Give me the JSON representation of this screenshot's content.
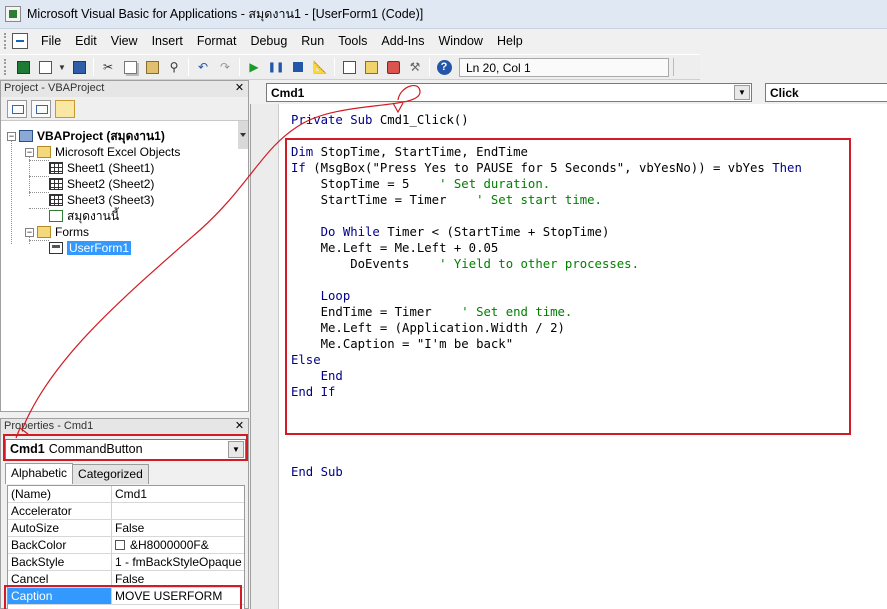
{
  "window": {
    "title": "Microsoft Visual Basic for Applications - สมุดงาน1 - [UserForm1 (Code)]"
  },
  "menu": {
    "items": [
      "File",
      "Edit",
      "View",
      "Insert",
      "Format",
      "Debug",
      "Run",
      "Tools",
      "Add-Ins",
      "Window",
      "Help"
    ]
  },
  "toolbar": {
    "position": "Ln 20, Col 1"
  },
  "project": {
    "title": "Project - VBAProject",
    "close": "✕",
    "tree": {
      "root": "VBAProject (สมุดงาน1)",
      "excel_objects": "Microsoft Excel Objects",
      "sheets": [
        "Sheet1 (Sheet1)",
        "Sheet2 (Sheet2)",
        "Sheet3 (Sheet3)"
      ],
      "workbook": "สมุดงานนี้",
      "forms": "Forms",
      "form": "UserForm1"
    }
  },
  "properties": {
    "title": "Properties - Cmd1",
    "close": "✕",
    "object_name": "Cmd1",
    "object_type": "CommandButton",
    "tabs": [
      "Alphabetic",
      "Categorized"
    ],
    "rows": [
      {
        "name": "(Name)",
        "value": "Cmd1"
      },
      {
        "name": "Accelerator",
        "value": ""
      },
      {
        "name": "AutoSize",
        "value": "False"
      },
      {
        "name": "BackColor",
        "value": "&H8000000F&"
      },
      {
        "name": "BackStyle",
        "value": "1 - fmBackStyleOpaque"
      },
      {
        "name": "Cancel",
        "value": "False"
      },
      {
        "name": "Caption",
        "value": "MOVE USERFORM"
      }
    ]
  },
  "code": {
    "object_combo": "Cmd1",
    "proc_combo": "Click",
    "lines": [
      {
        "kw1": "Private Sub ",
        "rest": "Cmd1_Click()",
        "comment": ""
      },
      {
        "kw1": "",
        "rest": "",
        "comment": ""
      },
      {
        "kw1": "Dim ",
        "rest": "StopTime, StartTime, EndTime",
        "comment": ""
      },
      {
        "kw1": "If ",
        "rest": "(MsgBox(\"Press Yes to PAUSE for 5 Seconds\", vbYesNo)) = vbYes ",
        "kw2": "Then",
        "comment": ""
      },
      {
        "kw1": "",
        "rest": "    StopTime = 5    ",
        "comment": "' Set duration."
      },
      {
        "kw1": "",
        "rest": "    StartTime = Timer    ",
        "comment": "' Set start time."
      },
      {
        "kw1": "",
        "rest": "",
        "comment": ""
      },
      {
        "kw1": "    Do While ",
        "rest": "Timer < (StartTime + StopTime)",
        "comment": ""
      },
      {
        "kw1": "",
        "rest": "    Me.Left = Me.Left + 0.05",
        "comment": ""
      },
      {
        "kw1": "",
        "rest": "        DoEvents    ",
        "comment": "' Yield to other processes."
      },
      {
        "kw1": "",
        "rest": "",
        "comment": ""
      },
      {
        "kw1": "    Loop",
        "rest": "",
        "comment": ""
      },
      {
        "kw1": "",
        "rest": "    EndTime = Timer    ",
        "comment": "' Set end time."
      },
      {
        "kw1": "",
        "rest": "    Me.Left = (Application.Width / 2)",
        "comment": ""
      },
      {
        "kw1": "",
        "rest": "    Me.Caption = \"I'm be back\"",
        "comment": ""
      },
      {
        "kw1": "Else",
        "rest": "",
        "comment": ""
      },
      {
        "kw1": "    End",
        "rest": "",
        "comment": ""
      },
      {
        "kw1": "End If",
        "rest": "",
        "comment": ""
      },
      {
        "kw1": "",
        "rest": "",
        "comment": ""
      },
      {
        "kw1": "",
        "rest": "",
        "comment": ""
      },
      {
        "kw1": "",
        "rest": "",
        "comment": ""
      },
      {
        "kw1": "",
        "rest": "",
        "comment": ""
      },
      {
        "kw1": "End Sub",
        "rest": "",
        "comment": ""
      }
    ]
  },
  "colors": {
    "keyword": "#00008b",
    "comment": "#007f00",
    "highlight_box": "#d01c24",
    "selection": "#3399ff"
  },
  "icons": [
    "excel-icon",
    "insert-userform-icon",
    "save-icon",
    "cut-icon",
    "copy-icon",
    "paste-icon",
    "find-icon",
    "undo-icon",
    "redo-icon",
    "run-icon",
    "break-icon",
    "reset-icon",
    "design-mode-icon",
    "project-explorer-icon",
    "properties-window-icon",
    "object-browser-icon",
    "toolbox-icon",
    "help-icon"
  ]
}
